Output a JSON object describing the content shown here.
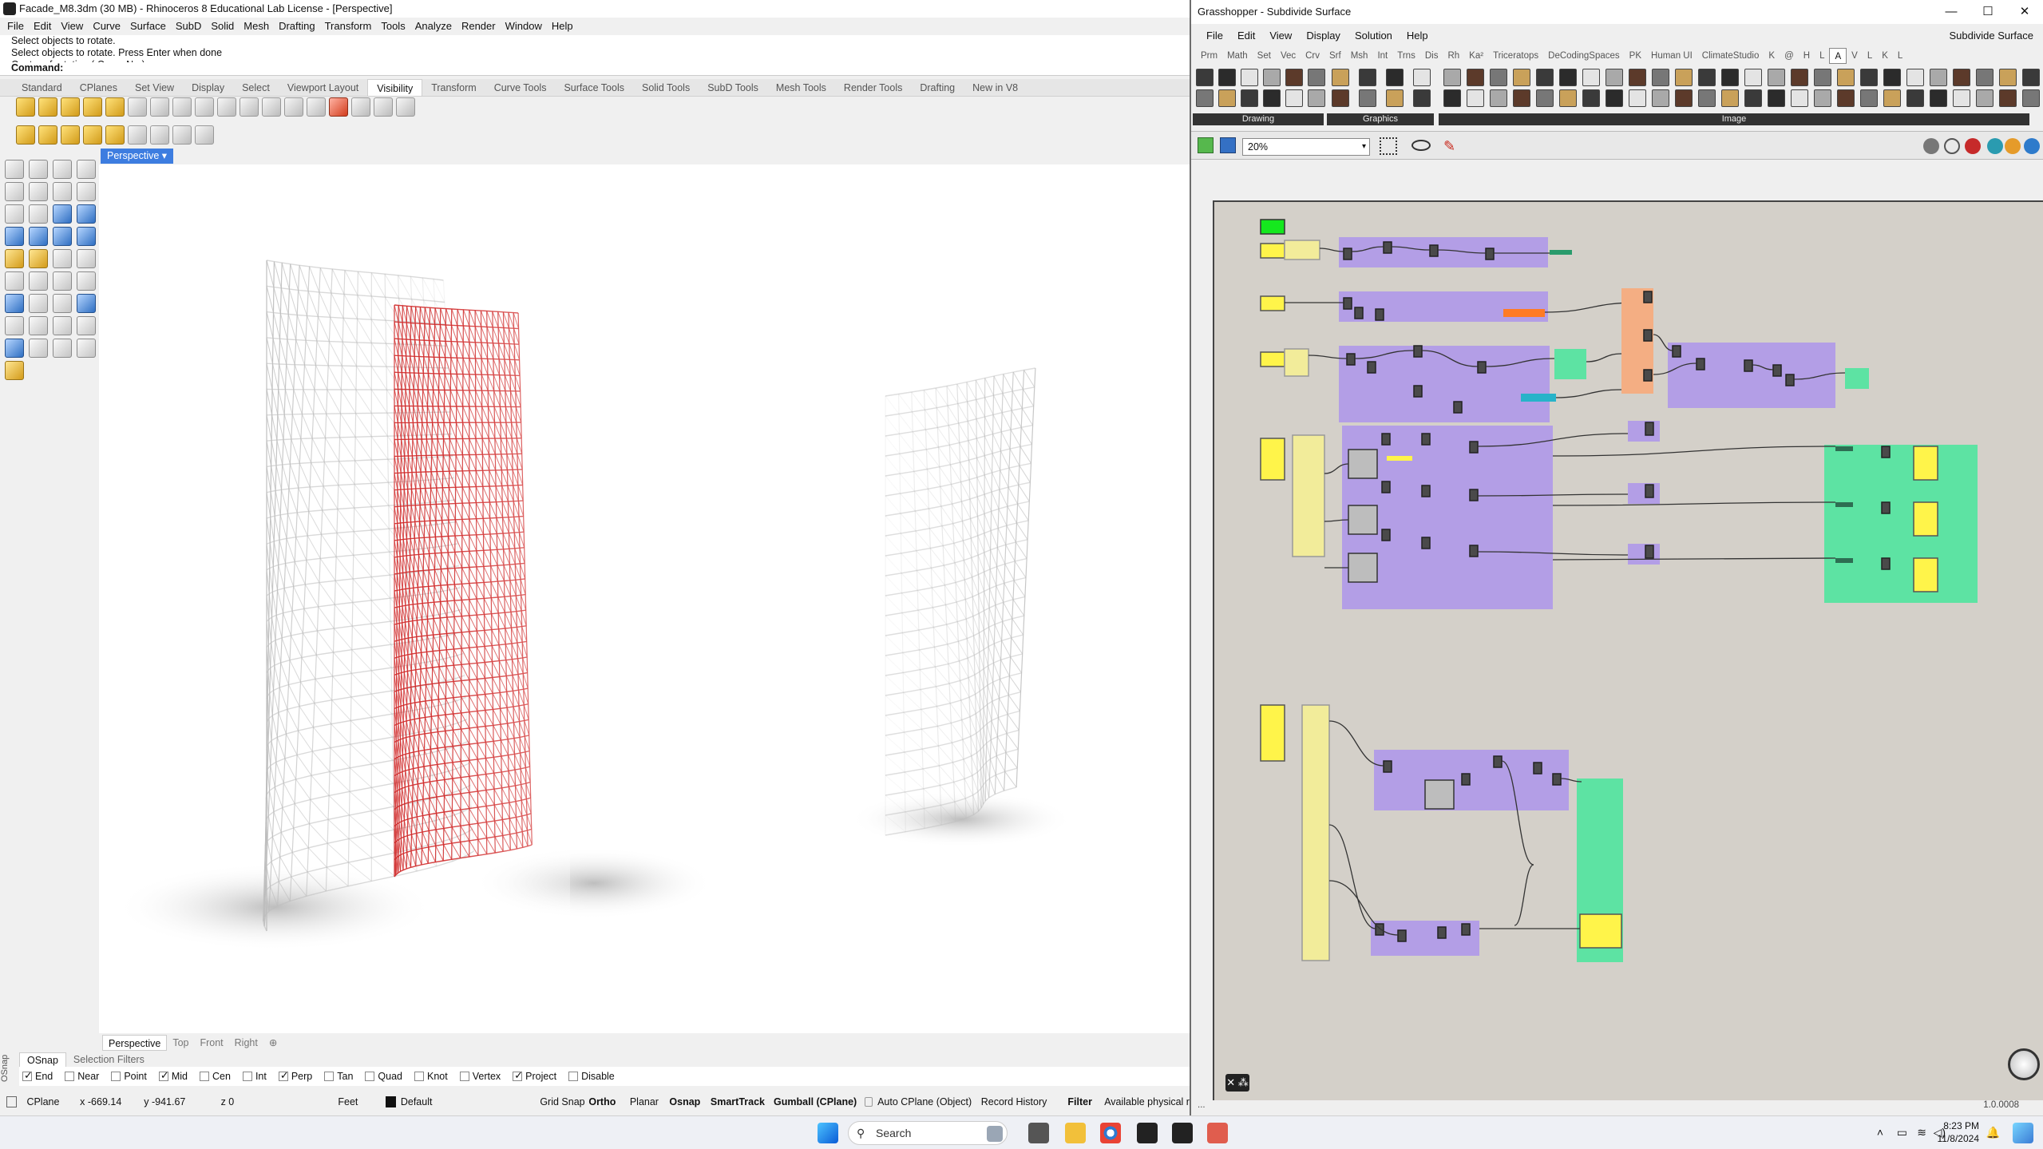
{
  "rhino": {
    "title": "Facade_M8.3dm (30 MB) - Rhinoceros 8 Educational Lab License - [Perspective]",
    "menu": [
      "File",
      "Edit",
      "View",
      "Curve",
      "Surface",
      "SubD",
      "Solid",
      "Mesh",
      "Drafting",
      "Transform",
      "Tools",
      "Analyze",
      "Render",
      "Window",
      "Help"
    ],
    "command_history": [
      "Select objects to rotate.",
      "Select objects to rotate. Press Enter when done",
      "Center of rotation ( Copy=No )"
    ],
    "command_prompt": "Command:",
    "toolbar_tabs": [
      "Standard",
      "CPlanes",
      "Set View",
      "Display",
      "Select",
      "Viewport Layout",
      "Visibility",
      "Transform",
      "Curve Tools",
      "Surface Tools",
      "Solid Tools",
      "SubD Tools",
      "Mesh Tools",
      "Render Tools",
      "Drafting",
      "New in V8"
    ],
    "active_toolbar_tab": "Visibility",
    "viewport_label": "Perspective",
    "viewport_tabs": [
      "Perspective",
      "Top",
      "Front",
      "Right"
    ],
    "osnap_tabs": [
      "OSnap",
      "Selection Filters"
    ],
    "osnap_side_label": "OSnap",
    "osnap_items": [
      {
        "label": "End",
        "checked": true
      },
      {
        "label": "Near",
        "checked": false
      },
      {
        "label": "Point",
        "checked": false
      },
      {
        "label": "Mid",
        "checked": true
      },
      {
        "label": "Cen",
        "checked": false
      },
      {
        "label": "Int",
        "checked": false
      },
      {
        "label": "Perp",
        "checked": true
      },
      {
        "label": "Tan",
        "checked": false
      },
      {
        "label": "Quad",
        "checked": false
      },
      {
        "label": "Knot",
        "checked": false
      },
      {
        "label": "Vertex",
        "checked": false
      },
      {
        "label": "Project",
        "checked": true
      },
      {
        "label": "Disable",
        "checked": false
      }
    ],
    "status": {
      "cplane": "CPlane",
      "x": "x -669.14",
      "y": "y -941.67",
      "z": "z 0",
      "units": "Feet",
      "layer": "Default",
      "grid_snap": "Grid Snap",
      "ortho": "Ortho",
      "planar": "Planar",
      "osnap": "Osnap",
      "smarttrack": "SmartTrack",
      "gumball": "Gumball (CPlane)",
      "auto_cplane": "Auto CPlane (Object)",
      "record_history": "Record History",
      "filter": "Filter",
      "available": "Available physical r"
    },
    "colors": {
      "selected_red": "#d02a2a",
      "wire_grey": "#bdbdbd",
      "viewport_label_bg": "#3d7de0"
    }
  },
  "grasshopper": {
    "title": "Grasshopper - Subdivide Surface",
    "menu": [
      "File",
      "Edit",
      "View",
      "Display",
      "Solution",
      "Help"
    ],
    "document_name": "Subdivide Surface",
    "tabs": [
      "Prm",
      "Math",
      "Set",
      "Vec",
      "Crv",
      "Srf",
      "Msh",
      "Int",
      "Trns",
      "Dis",
      "Rh",
      "Ka²",
      "Triceratops",
      "DeCodingSpaces",
      "PK",
      "Human UI",
      "ClimateStudio",
      "K",
      "@",
      "H",
      "L",
      "A",
      "V",
      "L",
      "K",
      "L"
    ],
    "active_tab": "A",
    "groups": [
      "Drawing",
      "Graphics",
      "Image"
    ],
    "zoom": "20%",
    "status_left": "...",
    "version": "1.0.0008",
    "colors": {
      "canvas": "#d4d0c9",
      "cluster_purple": "#b39ee6",
      "group_green": "#5de3a3",
      "group_orange": "#f4ae83",
      "panel_yellow": "#f2ec9a",
      "slider_yellow": "#fff44a",
      "toggle_green": "#15e81e"
    }
  },
  "taskbar": {
    "search_placeholder": "Search",
    "time": "8:23 PM",
    "date": "11/8/2024"
  }
}
